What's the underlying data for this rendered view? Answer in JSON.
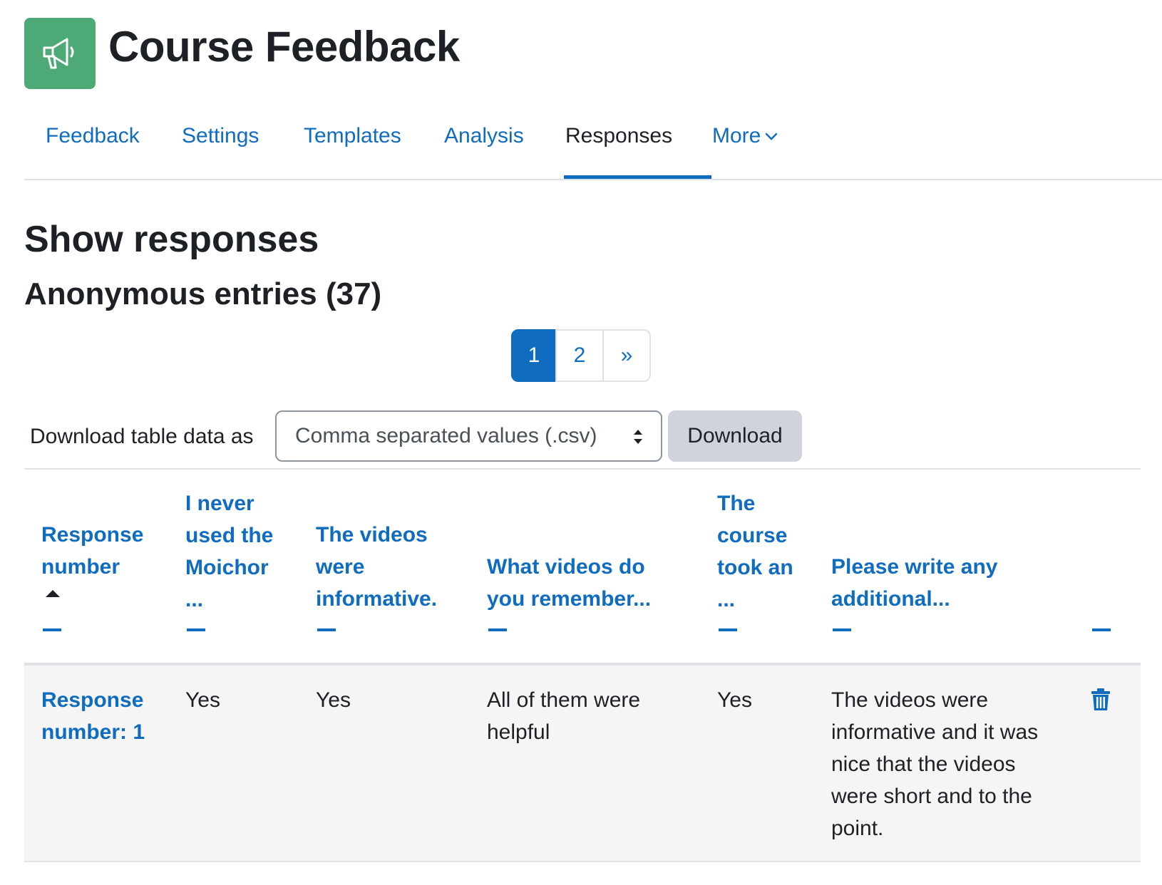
{
  "header": {
    "title": "Course Feedback",
    "icon": "megaphone-icon",
    "icon_bg": "#4daa77"
  },
  "nav": {
    "tabs": [
      {
        "label": "Feedback",
        "active": false
      },
      {
        "label": "Settings",
        "active": false
      },
      {
        "label": "Templates",
        "active": false
      },
      {
        "label": "Analysis",
        "active": false
      },
      {
        "label": "Responses",
        "active": true
      },
      {
        "label": "More",
        "active": false
      }
    ]
  },
  "main": {
    "heading": "Show responses",
    "subheading": "Anonymous entries (37)"
  },
  "pagination": {
    "pages": [
      "1",
      "2",
      "»"
    ],
    "current": "1"
  },
  "download": {
    "label": "Download table data as",
    "selected_format": "Comma separated values (.csv)",
    "button_label": "Download"
  },
  "table": {
    "headers": [
      {
        "lines": [
          "Response",
          "number"
        ]
      },
      {
        "lines": [
          "I never",
          "used the",
          "Moichor",
          "..."
        ]
      },
      {
        "lines": [
          "The videos",
          "were",
          "informative."
        ]
      },
      {
        "lines": [
          "What videos do",
          "you remember..."
        ]
      },
      {
        "lines": [
          "The",
          "course",
          "took an",
          "..."
        ]
      },
      {
        "lines": [
          "Please write any",
          "additional..."
        ]
      }
    ],
    "rows": [
      {
        "response_number": [
          "Response",
          "number: 1"
        ],
        "col1": "Yes",
        "col2": "Yes",
        "col3": [
          "All of them were",
          "helpful"
        ],
        "col4": "Yes",
        "col5": [
          "The videos were",
          "informative and it was",
          "nice that the videos",
          "were short and to the",
          "point."
        ]
      }
    ]
  },
  "colors": {
    "link": "#0f6cbf",
    "text": "#1d2125",
    "row_bg": "#f5f5f5"
  }
}
